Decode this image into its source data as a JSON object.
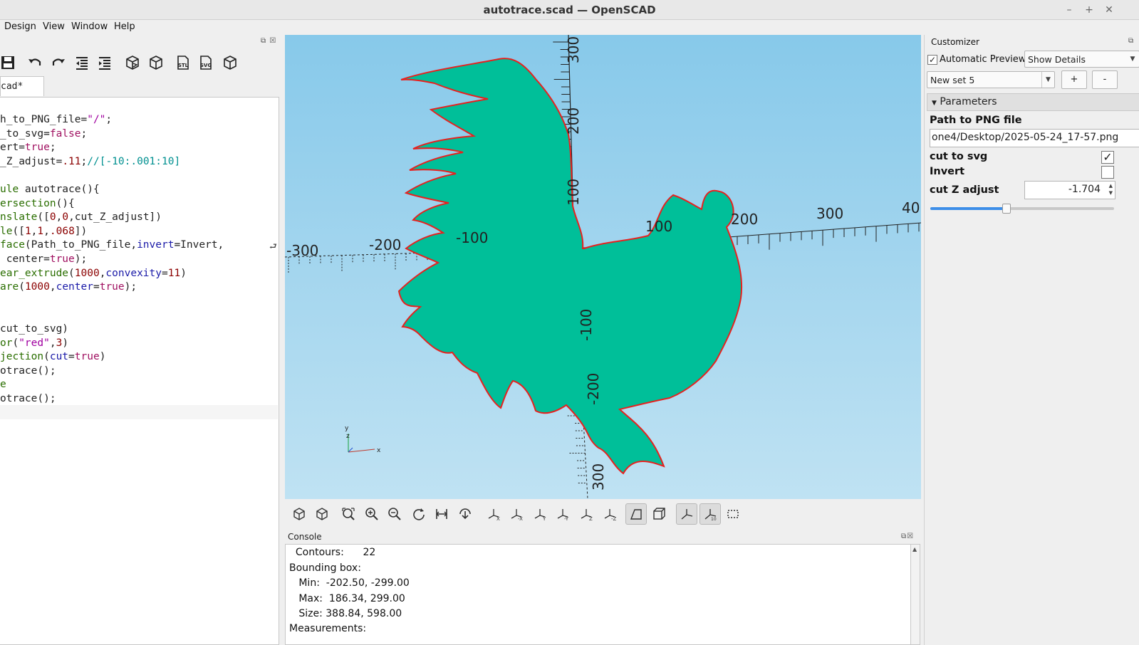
{
  "window": {
    "title": "autotrace.scad — OpenSCAD"
  },
  "window_controls": [
    "–",
    "+",
    "✕"
  ],
  "menu": [
    "Design",
    "View",
    "Window",
    "Help"
  ],
  "editor": {
    "tab_label": "cad*",
    "lines": [
      [
        [
          "h_to_PNG_file=",
          ""
        ],
        [
          "\"/\"",
          "str"
        ],
        [
          ";",
          ""
        ]
      ],
      [
        [
          "_to_svg=",
          ""
        ],
        [
          "false",
          "val"
        ],
        [
          ";",
          ""
        ]
      ],
      [
        [
          "ert=",
          ""
        ],
        [
          "true",
          "val"
        ],
        [
          ";",
          ""
        ]
      ],
      [
        [
          "_Z_adjust=",
          ""
        ],
        [
          ".11",
          "num"
        ],
        [
          ";",
          ""
        ],
        [
          "//[-10:.001:10]",
          "cmt"
        ]
      ],
      [],
      [
        [
          "ule ",
          "kw"
        ],
        [
          "autotrace(){",
          ""
        ]
      ],
      [
        [
          "ersection",
          "kw"
        ],
        [
          "(){",
          ""
        ]
      ],
      [
        [
          "nslate",
          "kw"
        ],
        [
          "([",
          ""
        ],
        [
          "0",
          "num"
        ],
        [
          ",",
          ""
        ],
        [
          "0",
          "num"
        ],
        [
          ",cut_Z_adjust])",
          ""
        ]
      ],
      [
        [
          "le",
          "kw"
        ],
        [
          "([",
          ""
        ],
        [
          "1",
          "num"
        ],
        [
          ",",
          ""
        ],
        [
          "1",
          "num"
        ],
        [
          ",",
          ""
        ],
        [
          ".068",
          "num"
        ],
        [
          "])",
          ""
        ]
      ],
      [
        [
          "face",
          "kw"
        ],
        [
          "(Path_to_PNG_file,",
          ""
        ],
        [
          "invert",
          "fn"
        ],
        [
          "=Invert,",
          ""
        ]
      ],
      [
        [
          " center=",
          ""
        ],
        [
          "true",
          "val"
        ],
        [
          ");",
          ""
        ]
      ],
      [
        [
          "ear_extrude",
          "kw"
        ],
        [
          "(",
          ""
        ],
        [
          "1000",
          "num"
        ],
        [
          ",",
          ""
        ],
        [
          "convexity",
          "fn"
        ],
        [
          "=",
          ""
        ],
        [
          "11",
          "num"
        ],
        [
          ")",
          ""
        ]
      ],
      [
        [
          "are",
          "kw"
        ],
        [
          "(",
          ""
        ],
        [
          "1000",
          "num"
        ],
        [
          ",",
          ""
        ],
        [
          "center",
          "fn"
        ],
        [
          "=",
          ""
        ],
        [
          "true",
          "val"
        ],
        [
          ");",
          ""
        ]
      ],
      [],
      [],
      [
        [
          "cut_to_svg)",
          ""
        ]
      ],
      [
        [
          "or",
          "kw"
        ],
        [
          "(",
          ""
        ],
        [
          "\"red\"",
          "str"
        ],
        [
          ",",
          ""
        ],
        [
          "3",
          "num"
        ],
        [
          ")",
          ""
        ]
      ],
      [
        [
          "jection",
          "kw"
        ],
        [
          "(",
          ""
        ],
        [
          "cut",
          "fn"
        ],
        [
          "=",
          ""
        ],
        [
          "true",
          "val"
        ],
        [
          ")",
          ""
        ]
      ],
      [
        [
          "otrace();",
          ""
        ]
      ],
      [
        [
          "e",
          "kw"
        ]
      ],
      [
        [
          "otrace();",
          ""
        ]
      ]
    ]
  },
  "viewport": {
    "axis_labels_x": [
      "-300",
      "-200",
      "-100",
      "100",
      "200",
      "300",
      "40"
    ],
    "axis_labels_y": [
      "300",
      "200",
      "100",
      "-100",
      "-200",
      "300"
    ],
    "gizmo": {
      "x": "x",
      "y": "y",
      "z": "z"
    },
    "colors": {
      "model": "#00bf99",
      "outline": "#e8201e"
    }
  },
  "console": {
    "header": "Console",
    "lines": [
      "  Contours:      22",
      "Bounding box:",
      "   Min:  -202.50, -299.00",
      "   Max:  186.34, 299.00",
      "   Size: 388.84, 598.00",
      "Measurements:"
    ]
  },
  "customizer": {
    "header": "Customizer",
    "auto_preview_label": "Automatic Preview",
    "auto_preview_checked": true,
    "show_details": "Show Details",
    "preset": "New set 5",
    "add_label": "+",
    "remove_label": "-",
    "params_header": "Parameters",
    "params": {
      "path_label": "Path to PNG file",
      "path_value": "one4/Desktop/2025-05-24_17-57.png",
      "cut_to_svg_label": "cut to svg",
      "cut_to_svg_checked": true,
      "invert_label": "Invert",
      "invert_checked": false,
      "cut_z_label": "cut Z adjust",
      "cut_z_value": "-1.704",
      "cut_z_slider_fraction": 0.415
    }
  }
}
